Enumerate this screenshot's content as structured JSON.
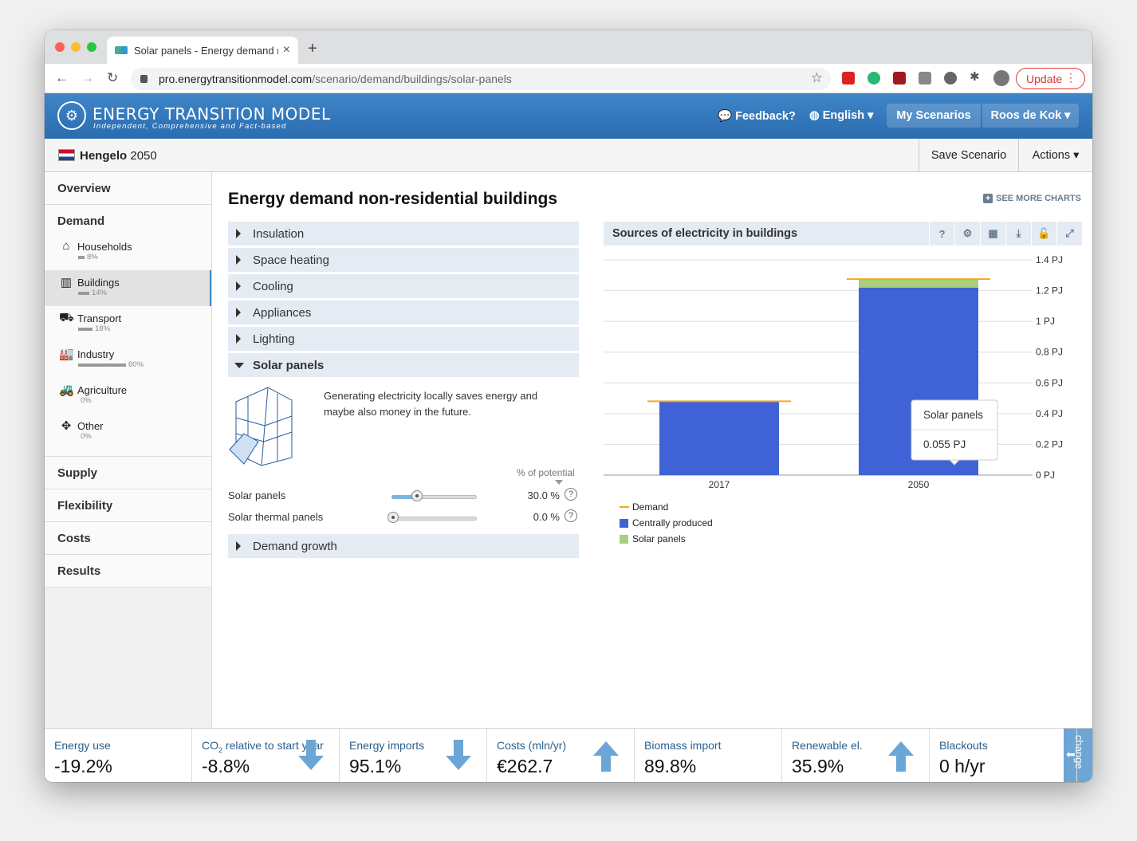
{
  "browser": {
    "tab_title": "Solar panels - Energy demand non-residential buildings",
    "url_host": "pro.energytransitionmodel.com",
    "url_path": "/scenario/demand/buildings/solar-panels",
    "update_label": "Update"
  },
  "header": {
    "logo_title": "ENERGY TRANSITION MODEL",
    "logo_subtitle": "Independent, Comprehensive and Fact-based",
    "feedback": "Feedback?",
    "language": "English",
    "my_scenarios": "My Scenarios",
    "user": "Roos de Kok"
  },
  "scenario": {
    "region": "Hengelo",
    "year": "2050",
    "save": "Save Scenario",
    "actions": "Actions"
  },
  "sidebar": {
    "overview": "Overview",
    "demand": "Demand",
    "items": [
      {
        "label": "Households",
        "pct": "8%",
        "share": 0.08,
        "icon": "house-icon"
      },
      {
        "label": "Buildings",
        "pct": "14%",
        "share": 0.14,
        "icon": "building-icon"
      },
      {
        "label": "Transport",
        "pct": "18%",
        "share": 0.18,
        "icon": "car-icon"
      },
      {
        "label": "Industry",
        "pct": "60%",
        "share": 0.6,
        "icon": "factory-icon"
      },
      {
        "label": "Agriculture",
        "pct": "0%",
        "share": 0.0,
        "icon": "tractor-icon"
      },
      {
        "label": "Other",
        "pct": "0%",
        "share": 0.0,
        "icon": "move-arrows-icon"
      }
    ],
    "supply": "Supply",
    "flexibility": "Flexibility",
    "costs": "Costs",
    "results": "Results"
  },
  "main": {
    "title": "Energy demand non-residential buildings",
    "see_more": "SEE MORE CHARTS",
    "sections": [
      "Insulation",
      "Space heating",
      "Cooling",
      "Appliances",
      "Lighting",
      "Solar panels"
    ],
    "demand_growth": "Demand growth",
    "solar_description": "Generating electricity locally saves energy and maybe also money in the future.",
    "potential_label": "% of potential",
    "sliders": [
      {
        "label": "Solar panels",
        "value": "30.0 %",
        "fraction": 0.3
      },
      {
        "label": "Solar thermal panels",
        "value": "0.0 %",
        "fraction": 0.0
      }
    ]
  },
  "chart_panel": {
    "title": "Sources of electricity in buildings",
    "help_label": "?",
    "tools": [
      "question-icon",
      "settings-icon",
      "table-icon",
      "download-icon",
      "unlock-icon",
      "expand-icon"
    ],
    "tooltip": {
      "label": "Solar panels",
      "value": "0.055 PJ"
    }
  },
  "chart_data": {
    "type": "bar",
    "stacked": true,
    "categories": [
      "2017",
      "2050"
    ],
    "series": [
      {
        "name": "Centrally produced",
        "values": [
          0.48,
          1.22
        ],
        "color": "#3f63d6"
      },
      {
        "name": "Solar panels",
        "values": [
          0.0,
          0.055
        ],
        "color": "#a8cf7a"
      }
    ],
    "lines": [
      {
        "name": "Demand",
        "values": [
          0.48,
          1.275
        ],
        "color": "#f5a623"
      }
    ],
    "ylim": [
      0,
      1.4
    ],
    "yticks": [
      "0 PJ",
      "0.2 PJ",
      "0.4 PJ",
      "0.6 PJ",
      "0.8 PJ",
      "1 PJ",
      "1.2 PJ",
      "1.4 PJ"
    ],
    "legend": [
      "Demand",
      "Centrally produced",
      "Solar panels"
    ],
    "legend_position": "bottom-left",
    "grid": true
  },
  "kpis": [
    {
      "label": "Energy use",
      "value": "-19.2%",
      "arrow": ""
    },
    {
      "label_pre": "CO",
      "label_sub": "2",
      "label_post": " relative to start year",
      "value": "-8.8%",
      "arrow": "down"
    },
    {
      "label": "Energy imports",
      "value": "95.1%",
      "arrow": "down"
    },
    {
      "label": "Costs (mln/yr)",
      "value": "€262.7",
      "arrow": "up"
    },
    {
      "label": "Biomass import",
      "value": "89.8%",
      "arrow": ""
    },
    {
      "label": "Renewable el.",
      "value": "35.9%",
      "arrow": "up"
    },
    {
      "label": "Blackouts",
      "value": "0 h/yr",
      "arrow": ""
    }
  ],
  "change_tab": "change",
  "colors": {
    "brand": "#2f74b8",
    "accent": "#6ba6d6",
    "kpi_label": "#2b5f8e"
  }
}
